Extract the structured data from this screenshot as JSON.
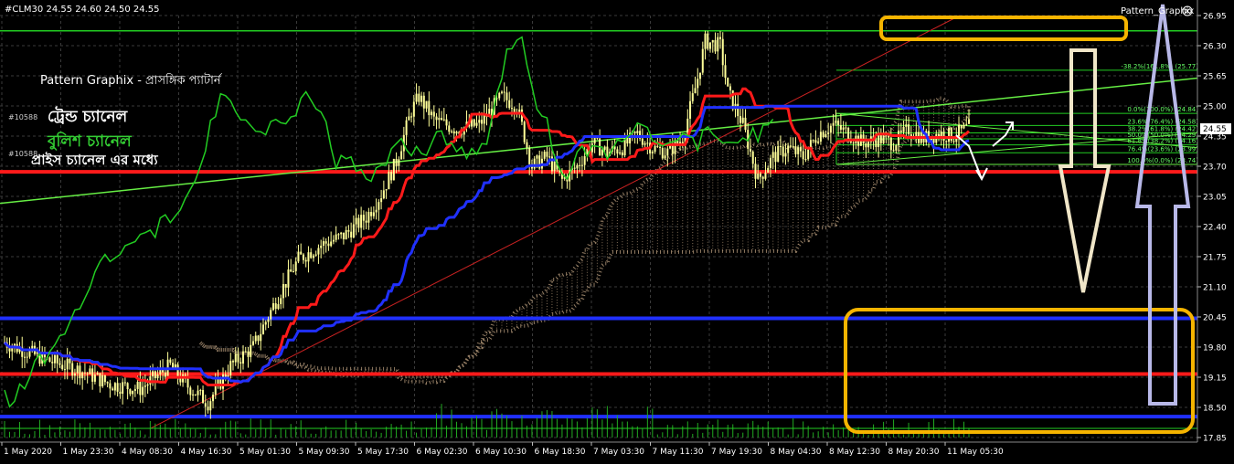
{
  "header": {
    "symbol_info": "#CLM30  24.55 24.60 24.50 24.55",
    "indicator_name": "Pattern_Graphix",
    "close_icon": "close-circle-icon"
  },
  "annotations": {
    "title": "Pattern Graphix - প্রাসঙ্গিক প্যাটার্ন",
    "trend_channel": "ট্রেন্ড চ্যানেল",
    "bullish_channel": "বুলিশ চ্যানেল",
    "price_in_channel": "প্রাইস চ্যানেল এর মধ্যে",
    "obj_label_1": "#10588",
    "obj_label_2": "#10588"
  },
  "price_tag": "24.55",
  "colors": {
    "background": "#000000",
    "grid": "#3a3a3a",
    "candle": "#ffff99",
    "red_line": "#ff1a1a",
    "blue_line": "#2030ff",
    "green_line": "#22cc22",
    "trend_line": "#66ee44",
    "cloud": "#b59a7a",
    "orange_box": "#f5b400",
    "down_arrow": "#f0e6c8",
    "up_arrow": "#b8b8e8",
    "text": "#ffffff",
    "bullish_text": "#33cc33"
  },
  "fib_labels": [
    "-38.2%(161.8%) (25.77)",
    "0.0%(100.0%) (24.84)",
    "23.6%(76.4%) (24.58)",
    "38.2%(61.8%) (24.42)",
    "50.0%(50.0%) (24.29)",
    "61.8%(38.2%) (24.16)",
    "76.4%(23.6%) (23.99)",
    "100.0%(0.0%) (23.74)"
  ],
  "chart_data": {
    "type": "candlestick",
    "symbol": "#CLM30",
    "timeframe": "M30",
    "ohlc_header": {
      "open": 24.55,
      "high": 24.6,
      "low": 24.5,
      "close": 24.55
    },
    "ylim": [
      17.85,
      26.95
    ],
    "y_ticks": [
      "26.95",
      "26.30",
      "25.65",
      "25.00",
      "24.35",
      "23.70",
      "23.05",
      "22.40",
      "21.75",
      "21.10",
      "20.45",
      "19.80",
      "19.15",
      "18.50",
      "17.85"
    ],
    "x_ticks": [
      "1 May 2020",
      "1 May 23:30",
      "4 May 08:30",
      "4 May 16:30",
      "5 May 01:30",
      "5 May 09:30",
      "5 May 17:30",
      "6 May 02:30",
      "6 May 10:30",
      "6 May 18:30",
      "7 May 03:30",
      "7 May 11:30",
      "7 May 19:30",
      "8 May 04:30",
      "8 May 12:30",
      "8 May 20:30",
      "11 May 05:30"
    ],
    "horizontal_levels": [
      {
        "price": 23.58,
        "color": "#ff1a1a"
      },
      {
        "price": 20.42,
        "color": "#2030ff"
      },
      {
        "price": 19.22,
        "color": "#ff1a1a"
      },
      {
        "price": 18.3,
        "color": "#2030ff"
      },
      {
        "price": 26.62,
        "color": "#22cc22"
      }
    ],
    "fib_levels": [
      25.77,
      24.84,
      24.58,
      24.42,
      24.29,
      24.16,
      23.99,
      23.74
    ],
    "price_path": [
      [
        0,
        19.9
      ],
      [
        6,
        19.5
      ],
      [
        10,
        19.3
      ],
      [
        14,
        19.0
      ],
      [
        18,
        18.9
      ],
      [
        22,
        19.4
      ],
      [
        24,
        19.0
      ],
      [
        27,
        18.6
      ],
      [
        30,
        19.4
      ],
      [
        33,
        19.8
      ],
      [
        36,
        20.8
      ],
      [
        39,
        21.7
      ],
      [
        42,
        22.0
      ],
      [
        45,
        22.2
      ],
      [
        48,
        22.6
      ],
      [
        50,
        23.1
      ],
      [
        52,
        23.8
      ],
      [
        54,
        24.9
      ],
      [
        55,
        25.2
      ],
      [
        57,
        24.7
      ],
      [
        60,
        24.5
      ],
      [
        63,
        24.6
      ],
      [
        66,
        25.2
      ],
      [
        68,
        25.0
      ],
      [
        70,
        23.7
      ],
      [
        72,
        23.9
      ],
      [
        74,
        23.4
      ],
      [
        76,
        23.7
      ],
      [
        78,
        24.2
      ],
      [
        80,
        24.0
      ],
      [
        82,
        24.1
      ],
      [
        84,
        24.4
      ],
      [
        86,
        24.1
      ],
      [
        88,
        24.0
      ],
      [
        90,
        24.3
      ],
      [
        92,
        25.6
      ],
      [
        93,
        26.4
      ],
      [
        95,
        26.3
      ],
      [
        96,
        25.3
      ],
      [
        98,
        24.6
      ],
      [
        99,
        24.0
      ],
      [
        100,
        23.4
      ],
      [
        102,
        23.9
      ],
      [
        104,
        24.1
      ],
      [
        106,
        23.9
      ],
      [
        108,
        24.4
      ],
      [
        110,
        24.6
      ],
      [
        112,
        24.4
      ],
      [
        114,
        24.2
      ],
      [
        116,
        24.3
      ],
      [
        118,
        24.2
      ],
      [
        120,
        24.5
      ],
      [
        122,
        24.3
      ],
      [
        124,
        24.4
      ],
      [
        126,
        24.35
      ],
      [
        128,
        24.55
      ]
    ]
  }
}
